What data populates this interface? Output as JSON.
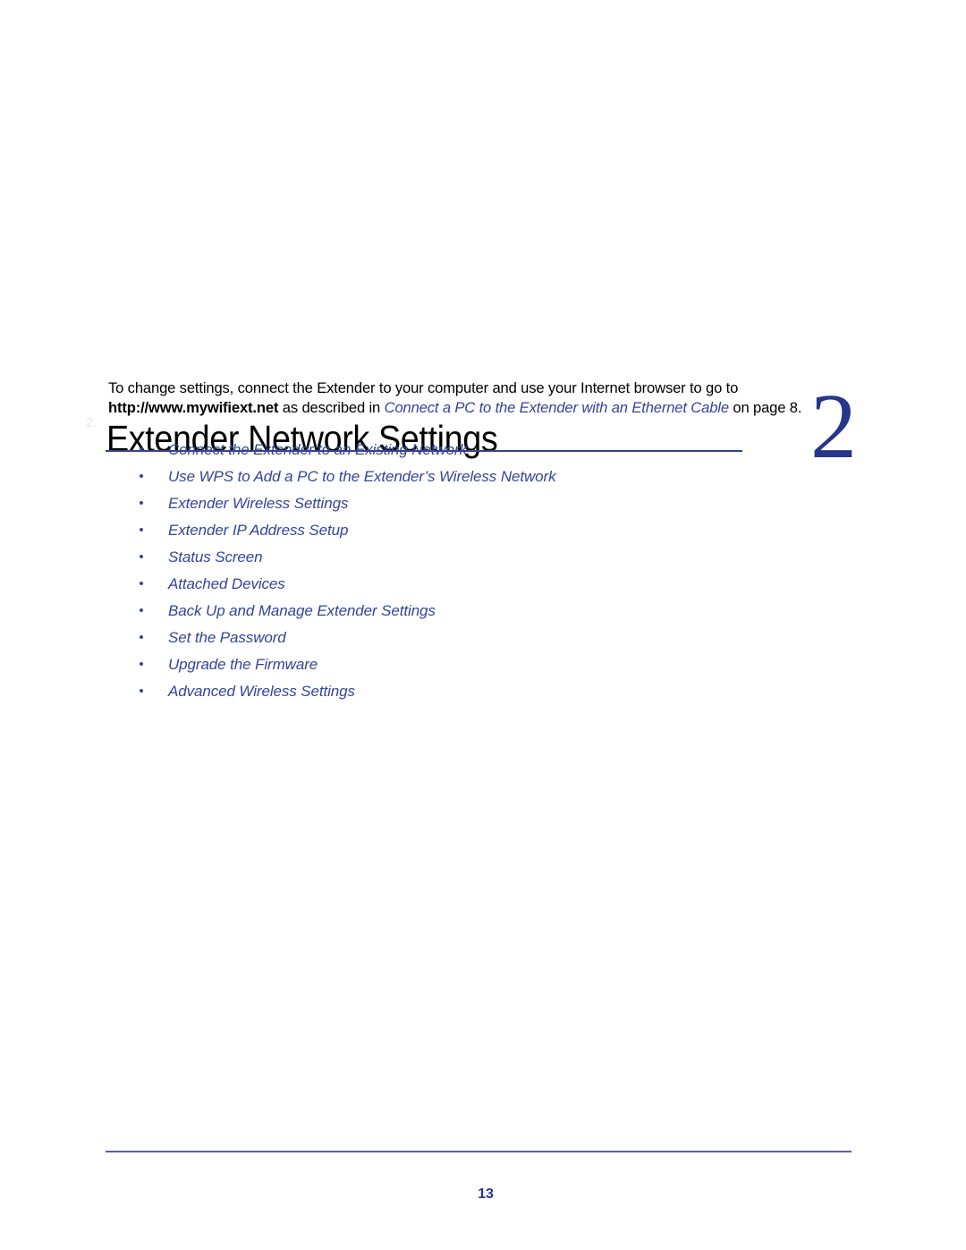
{
  "chapter": {
    "title": "Extender Network Settings",
    "number": "2",
    "watermark": "2."
  },
  "intro": {
    "part1": "To change settings, connect the Extender to your computer and use your Internet browser to go to ",
    "url": "http://www.mywifiext.net",
    "part2": " as described in ",
    "xref": "Connect a PC to the Extender with an Ethernet Cable",
    "part3": " on page 8."
  },
  "links": [
    {
      "label": "Connect the Extender to an Existing Network"
    },
    {
      "label": "Use WPS to Add a PC to the Extender’s Wireless Network"
    },
    {
      "label": "Extender Wireless Settings"
    },
    {
      "label": "Extender IP Address Setup"
    },
    {
      "label": "Status Screen"
    },
    {
      "label": "Attached Devices"
    },
    {
      "label": "Back Up and Manage Extender Settings"
    },
    {
      "label": "Set the Password"
    },
    {
      "label": "Upgrade the Firmware"
    },
    {
      "label": "Advanced Wireless Settings"
    }
  ],
  "bullet_glyph": "•",
  "footer": {
    "page_number": "13"
  },
  "colors": {
    "accent_blue": "#33449c",
    "chapter_number_blue": "#27358a",
    "rule_blue": "#3b3f8c",
    "footer_rule_blue": "#5b5fa8",
    "body_text": "#000000"
  }
}
